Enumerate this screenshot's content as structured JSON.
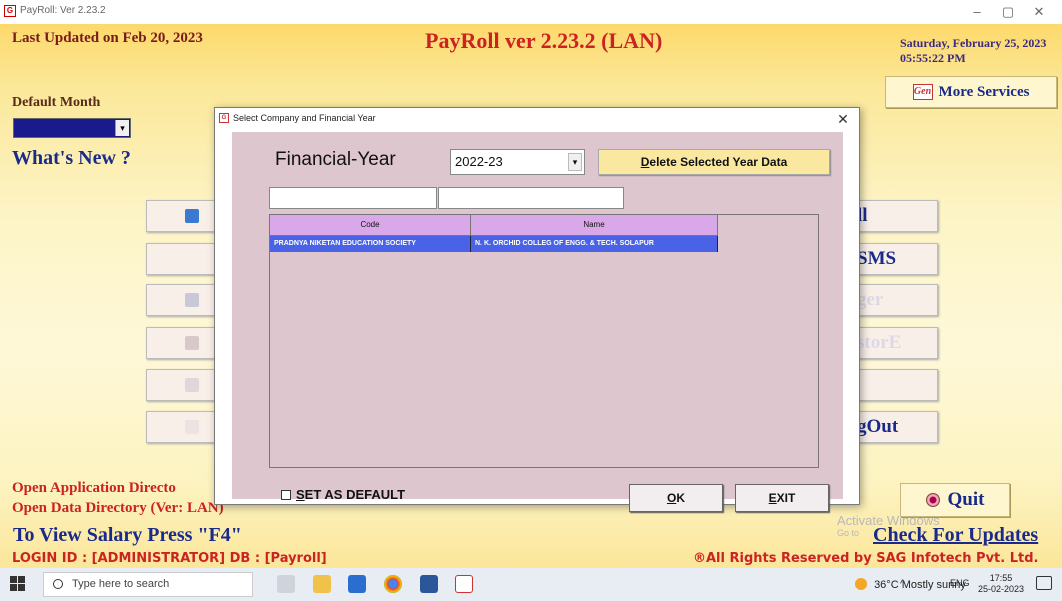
{
  "window": {
    "title": "PayRoll: Ver 2.23.2",
    "minimize": "–",
    "maximize": "▢",
    "close": "✕"
  },
  "header": {
    "last_updated": "Last Updated on Feb 20, 2023",
    "app_title": "PayRoll ver 2.23.2 (LAN)",
    "date": "Saturday, February 25, 2023",
    "time": "05:55:22 PM",
    "more_services": "More Services",
    "gen_logo": "Gen"
  },
  "left_panel": {
    "default_month_label": "Default Month",
    "default_month_value": "",
    "whats_new": "What's New ?"
  },
  "right_menu": [
    {
      "label": "ll",
      "faded": false
    },
    {
      "label": "SMS",
      "faded": false
    },
    {
      "label": "ger",
      "faded": true
    },
    {
      "label": "storE",
      "faded": true
    },
    {
      "label": "",
      "faded": false
    },
    {
      "label": "gOut",
      "faded": false
    }
  ],
  "footer": {
    "open_app_dir": "Open Application Directo",
    "open_data_dir": "Open Data Directory (Ver: LAN)",
    "view_salary": "To View Salary Press \"F4\"",
    "login": "LOGIN ID : [ADMINISTRATOR] DB : [Payroll]",
    "rights": "®All Rights Reserved by SAG Infotech Pvt. Ltd.",
    "quit": "Quit",
    "check_updates": "Check For Updates",
    "activate": "Activate Windows",
    "activate_sub": "Go to"
  },
  "dialog": {
    "title": "Select Company and Financial Year",
    "close": "✕",
    "fy_label": "Financial-Year",
    "fy_value": "2022-23",
    "delete_btn": "Delete Selected Year Data",
    "delete_btn_accel": "D",
    "delete_btn_rest": "elete Selected Year Data",
    "grid": {
      "columns": [
        "Code",
        "Name"
      ],
      "rows": [
        [
          "PRADNYA NIKETAN EDUCATION SOCIETY",
          "N. K. ORCHID COLLEG OF ENGG. & TECH. SOLAPUR"
        ]
      ]
    },
    "set_default": "SET AS DEFAULT",
    "set_default_accel": "S",
    "set_default_rest": "ET AS DEFAULT",
    "ok": "OK",
    "ok_accel": "O",
    "ok_rest": "K",
    "exit": "EXIT",
    "exit_accel": "E",
    "exit_rest": "XIT"
  },
  "taskbar": {
    "search_placeholder": "Type here to search",
    "weather": "36°C  Mostly sunny",
    "lang": "ENG",
    "clock_time": "17:55",
    "clock_date": "25-02-2023",
    "tray": "^"
  }
}
